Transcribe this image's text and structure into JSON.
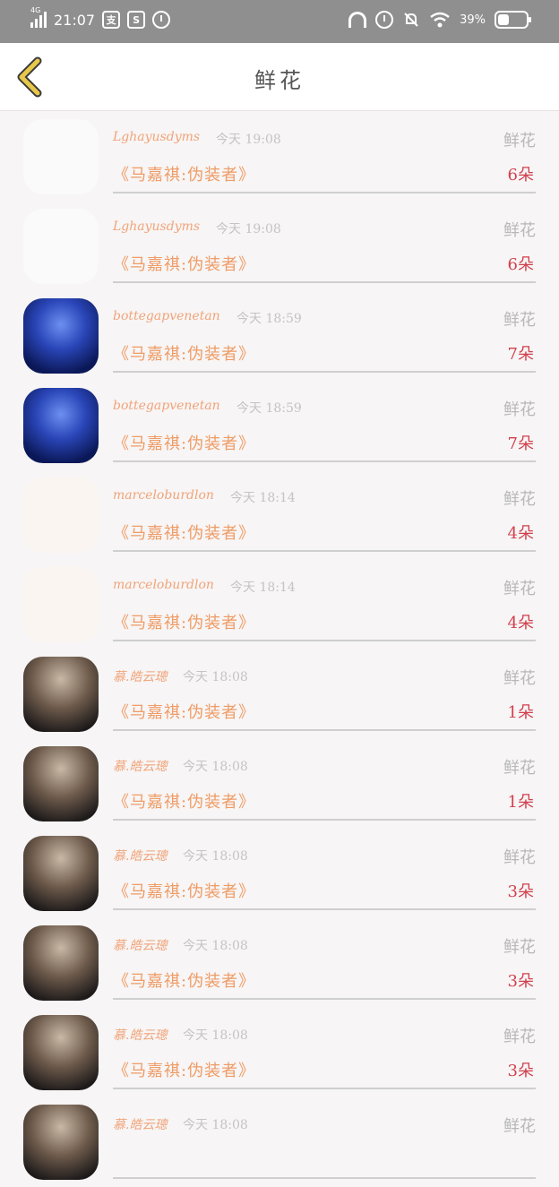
{
  "status_bar": {
    "network": "4G",
    "network_sub": "HD",
    "time": "21:07",
    "battery": "39%",
    "icons": [
      "signal-icon",
      "app-icon",
      "app-icon",
      "alarm-icon",
      "headset-icon",
      "alarm-icon",
      "mute-icon",
      "wifi-icon",
      "battery-icon"
    ]
  },
  "header": {
    "title": "鲜花",
    "back_icon": "chevron-left-icon",
    "accent": "#e8c84a"
  },
  "rows": [
    {
      "user": "Lghayusdyms",
      "time": "今天 19:08",
      "type": "鲜花",
      "song": "《马嘉祺:伪装者》",
      "count": "6朵",
      "avatar": "sketch"
    },
    {
      "user": "Lghayusdyms",
      "time": "今天 19:08",
      "type": "鲜花",
      "song": "《马嘉祺:伪装者》",
      "count": "6朵",
      "avatar": "sketch"
    },
    {
      "user": "bottegapvenetan",
      "time": "今天 18:59",
      "type": "鲜花",
      "song": "《马嘉祺:伪装者》",
      "count": "7朵",
      "avatar": "city"
    },
    {
      "user": "bottegapvenetan",
      "time": "今天 18:59",
      "type": "鲜花",
      "song": "《马嘉祺:伪装者》",
      "count": "7朵",
      "avatar": "city"
    },
    {
      "user": "marceloburdlon",
      "time": "今天 18:14",
      "type": "鲜花",
      "song": "《马嘉祺:伪装者》",
      "count": "4朵",
      "avatar": "cartoon"
    },
    {
      "user": "marceloburdlon",
      "time": "今天 18:14",
      "type": "鲜花",
      "song": "《马嘉祺:伪装者》",
      "count": "4朵",
      "avatar": "cartoon"
    },
    {
      "user": "慕.皓云璁",
      "time": "今天 18:08",
      "type": "鲜花",
      "song": "《马嘉祺:伪装者》",
      "count": "1朵",
      "avatar": "photo"
    },
    {
      "user": "慕.皓云璁",
      "time": "今天 18:08",
      "type": "鲜花",
      "song": "《马嘉祺:伪装者》",
      "count": "1朵",
      "avatar": "photo"
    },
    {
      "user": "慕.皓云璁",
      "time": "今天 18:08",
      "type": "鲜花",
      "song": "《马嘉祺:伪装者》",
      "count": "3朵",
      "avatar": "photo"
    },
    {
      "user": "慕.皓云璁",
      "time": "今天 18:08",
      "type": "鲜花",
      "song": "《马嘉祺:伪装者》",
      "count": "3朵",
      "avatar": "photo"
    },
    {
      "user": "慕.皓云璁",
      "time": "今天 18:08",
      "type": "鲜花",
      "song": "《马嘉祺:伪装者》",
      "count": "3朵",
      "avatar": "photo"
    },
    {
      "user": "慕.皓云璁",
      "time": "今天 18:08",
      "type": "鲜花",
      "song": "",
      "count": "",
      "avatar": "photo"
    }
  ]
}
